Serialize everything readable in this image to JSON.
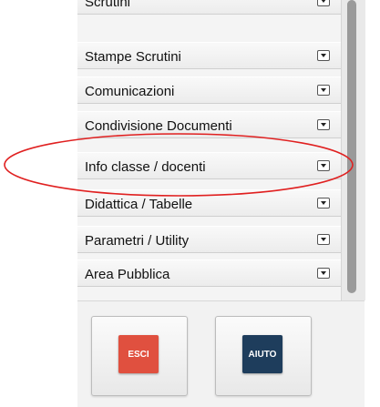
{
  "menu": {
    "items": [
      {
        "label": "Scrutini"
      },
      {
        "label": "Stampe Scrutini"
      },
      {
        "label": "Comunicazioni"
      },
      {
        "label": "Condivisione Documenti"
      },
      {
        "label": "Info classe / docenti"
      },
      {
        "label": "Didattica / Tabelle"
      },
      {
        "label": "Parametri / Utility"
      },
      {
        "label": "Area Pubblica"
      }
    ],
    "dropdown_icon": "chevron-down-box-icon"
  },
  "actions": {
    "esci_label": "ESCI",
    "aiuto_label": "AIUTO",
    "esci_color": "#e0503f",
    "aiuto_color": "#1e3d5c"
  },
  "annotation": {
    "color": "#e02020"
  }
}
